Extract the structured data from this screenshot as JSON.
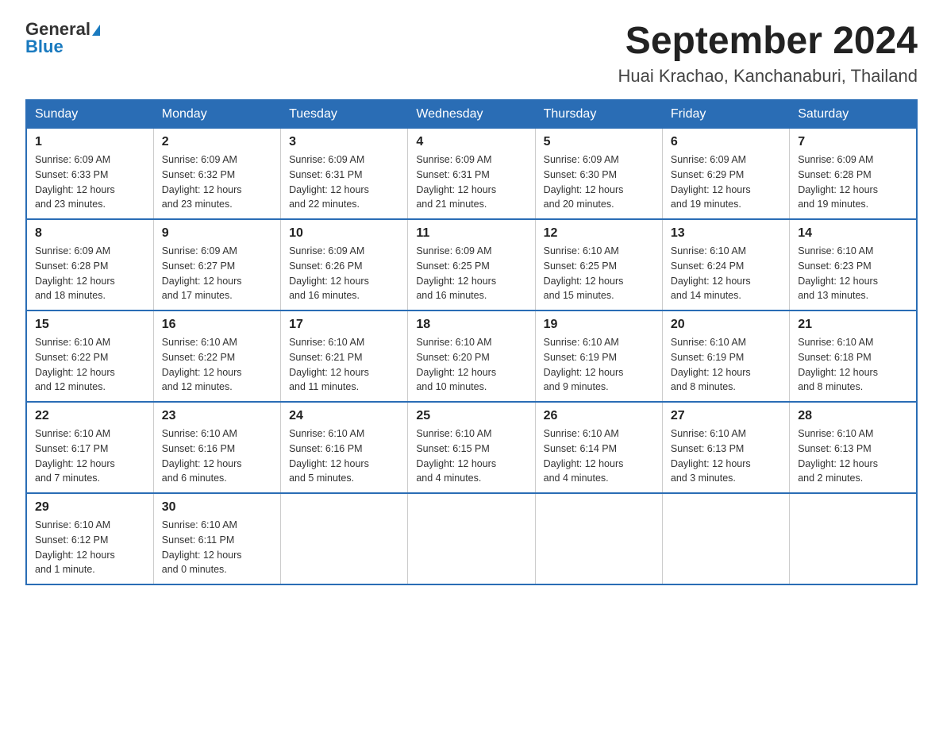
{
  "logo": {
    "text_general": "General",
    "text_blue": "Blue"
  },
  "title": "September 2024",
  "subtitle": "Huai Krachao, Kanchanaburi, Thailand",
  "weekdays": [
    "Sunday",
    "Monday",
    "Tuesday",
    "Wednesday",
    "Thursday",
    "Friday",
    "Saturday"
  ],
  "weeks": [
    [
      {
        "day": "1",
        "sunrise": "6:09 AM",
        "sunset": "6:33 PM",
        "daylight": "12 hours and 23 minutes."
      },
      {
        "day": "2",
        "sunrise": "6:09 AM",
        "sunset": "6:32 PM",
        "daylight": "12 hours and 23 minutes."
      },
      {
        "day": "3",
        "sunrise": "6:09 AM",
        "sunset": "6:31 PM",
        "daylight": "12 hours and 22 minutes."
      },
      {
        "day": "4",
        "sunrise": "6:09 AM",
        "sunset": "6:31 PM",
        "daylight": "12 hours and 21 minutes."
      },
      {
        "day": "5",
        "sunrise": "6:09 AM",
        "sunset": "6:30 PM",
        "daylight": "12 hours and 20 minutes."
      },
      {
        "day": "6",
        "sunrise": "6:09 AM",
        "sunset": "6:29 PM",
        "daylight": "12 hours and 19 minutes."
      },
      {
        "day": "7",
        "sunrise": "6:09 AM",
        "sunset": "6:28 PM",
        "daylight": "12 hours and 19 minutes."
      }
    ],
    [
      {
        "day": "8",
        "sunrise": "6:09 AM",
        "sunset": "6:28 PM",
        "daylight": "12 hours and 18 minutes."
      },
      {
        "day": "9",
        "sunrise": "6:09 AM",
        "sunset": "6:27 PM",
        "daylight": "12 hours and 17 minutes."
      },
      {
        "day": "10",
        "sunrise": "6:09 AM",
        "sunset": "6:26 PM",
        "daylight": "12 hours and 16 minutes."
      },
      {
        "day": "11",
        "sunrise": "6:09 AM",
        "sunset": "6:25 PM",
        "daylight": "12 hours and 16 minutes."
      },
      {
        "day": "12",
        "sunrise": "6:10 AM",
        "sunset": "6:25 PM",
        "daylight": "12 hours and 15 minutes."
      },
      {
        "day": "13",
        "sunrise": "6:10 AM",
        "sunset": "6:24 PM",
        "daylight": "12 hours and 14 minutes."
      },
      {
        "day": "14",
        "sunrise": "6:10 AM",
        "sunset": "6:23 PM",
        "daylight": "12 hours and 13 minutes."
      }
    ],
    [
      {
        "day": "15",
        "sunrise": "6:10 AM",
        "sunset": "6:22 PM",
        "daylight": "12 hours and 12 minutes."
      },
      {
        "day": "16",
        "sunrise": "6:10 AM",
        "sunset": "6:22 PM",
        "daylight": "12 hours and 12 minutes."
      },
      {
        "day": "17",
        "sunrise": "6:10 AM",
        "sunset": "6:21 PM",
        "daylight": "12 hours and 11 minutes."
      },
      {
        "day": "18",
        "sunrise": "6:10 AM",
        "sunset": "6:20 PM",
        "daylight": "12 hours and 10 minutes."
      },
      {
        "day": "19",
        "sunrise": "6:10 AM",
        "sunset": "6:19 PM",
        "daylight": "12 hours and 9 minutes."
      },
      {
        "day": "20",
        "sunrise": "6:10 AM",
        "sunset": "6:19 PM",
        "daylight": "12 hours and 8 minutes."
      },
      {
        "day": "21",
        "sunrise": "6:10 AM",
        "sunset": "6:18 PM",
        "daylight": "12 hours and 8 minutes."
      }
    ],
    [
      {
        "day": "22",
        "sunrise": "6:10 AM",
        "sunset": "6:17 PM",
        "daylight": "12 hours and 7 minutes."
      },
      {
        "day": "23",
        "sunrise": "6:10 AM",
        "sunset": "6:16 PM",
        "daylight": "12 hours and 6 minutes."
      },
      {
        "day": "24",
        "sunrise": "6:10 AM",
        "sunset": "6:16 PM",
        "daylight": "12 hours and 5 minutes."
      },
      {
        "day": "25",
        "sunrise": "6:10 AM",
        "sunset": "6:15 PM",
        "daylight": "12 hours and 4 minutes."
      },
      {
        "day": "26",
        "sunrise": "6:10 AM",
        "sunset": "6:14 PM",
        "daylight": "12 hours and 4 minutes."
      },
      {
        "day": "27",
        "sunrise": "6:10 AM",
        "sunset": "6:13 PM",
        "daylight": "12 hours and 3 minutes."
      },
      {
        "day": "28",
        "sunrise": "6:10 AM",
        "sunset": "6:13 PM",
        "daylight": "12 hours and 2 minutes."
      }
    ],
    [
      {
        "day": "29",
        "sunrise": "6:10 AM",
        "sunset": "6:12 PM",
        "daylight": "12 hours and 1 minute."
      },
      {
        "day": "30",
        "sunrise": "6:10 AM",
        "sunset": "6:11 PM",
        "daylight": "12 hours and 0 minutes."
      },
      null,
      null,
      null,
      null,
      null
    ]
  ],
  "labels": {
    "sunrise": "Sunrise:",
    "sunset": "Sunset:",
    "daylight": "Daylight:"
  }
}
